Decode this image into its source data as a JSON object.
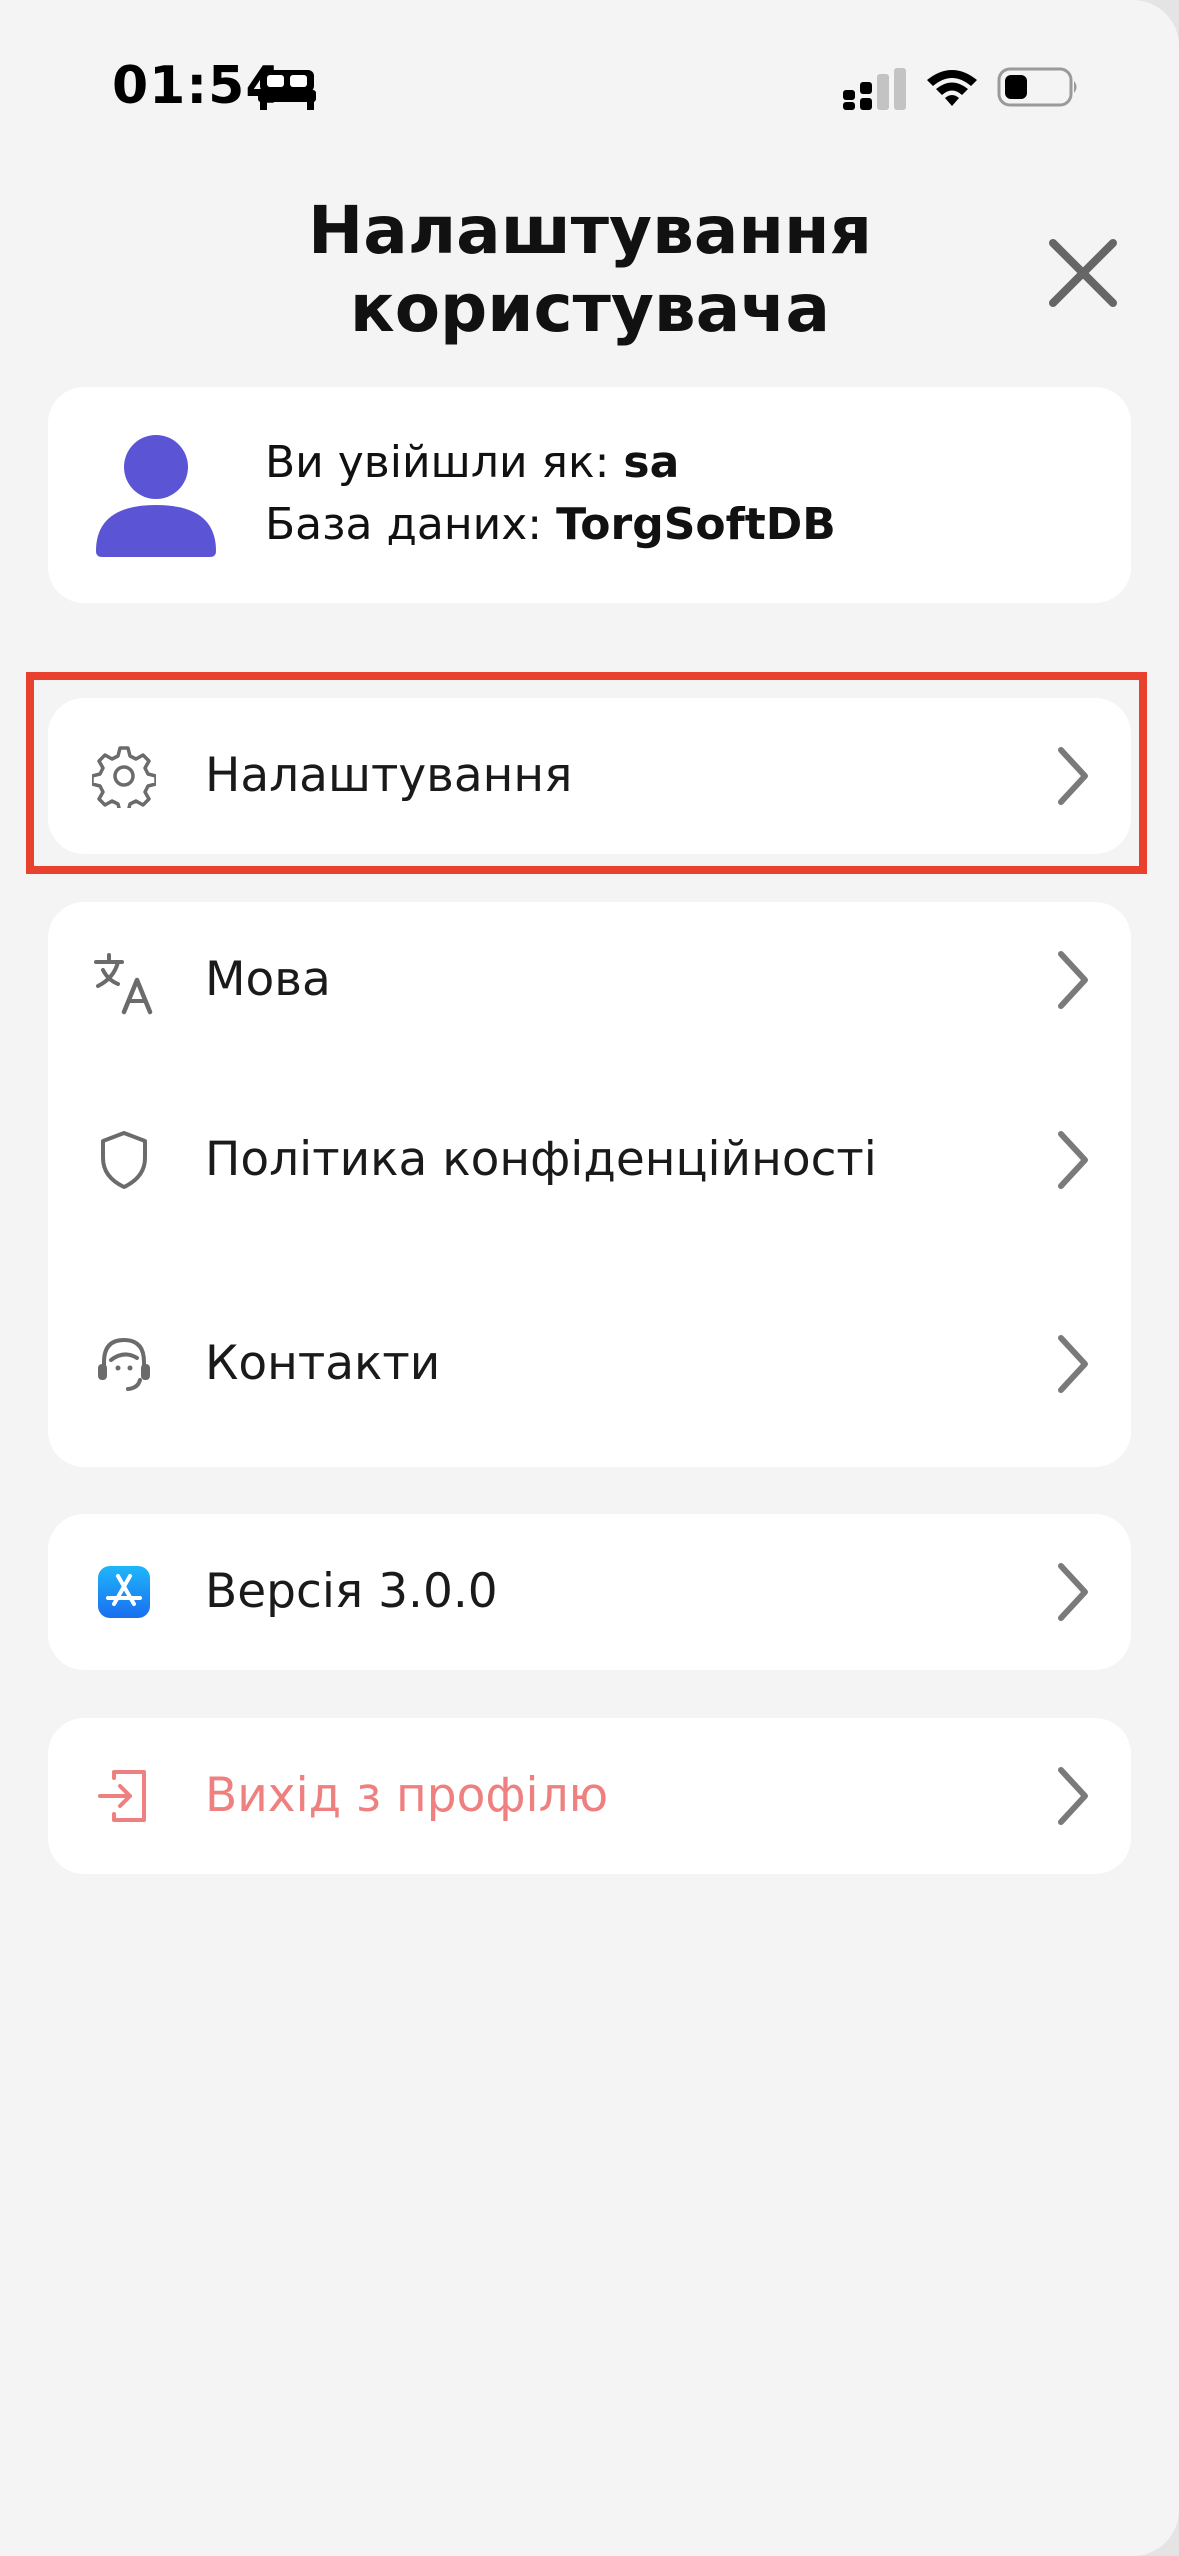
{
  "status_bar": {
    "time": "01:54",
    "icons": [
      "bed-icon",
      "cellular-signal-icon",
      "wifi-icon",
      "battery-icon"
    ]
  },
  "header": {
    "title": "Налаштування користувача",
    "close_icon": "close-icon"
  },
  "profile": {
    "logged_in_label": "Ви увійшли як: ",
    "user": "sa",
    "database_label": "База даних: ",
    "database": "TorgSoftDB",
    "avatar_icon": "user-avatar-icon",
    "avatar_color": "#5b55d6"
  },
  "menu": {
    "settings": {
      "label": "Налаштування",
      "icon": "gear-icon"
    },
    "language": {
      "label": "Мова",
      "icon": "translate-icon"
    },
    "privacy": {
      "label": "Політика конфіденційності",
      "icon": "shield-icon"
    },
    "contacts": {
      "label": "Контакти",
      "icon": "support-agent-icon"
    },
    "version": {
      "label": "Версія 3.0.0",
      "icon": "app-store-icon"
    },
    "logout": {
      "label": "Вихід з профілю",
      "icon": "logout-icon"
    }
  },
  "colors": {
    "highlight": "#e8412e",
    "logout_text": "#ee8080",
    "background": "#f4f4f4",
    "card": "#ffffff"
  }
}
